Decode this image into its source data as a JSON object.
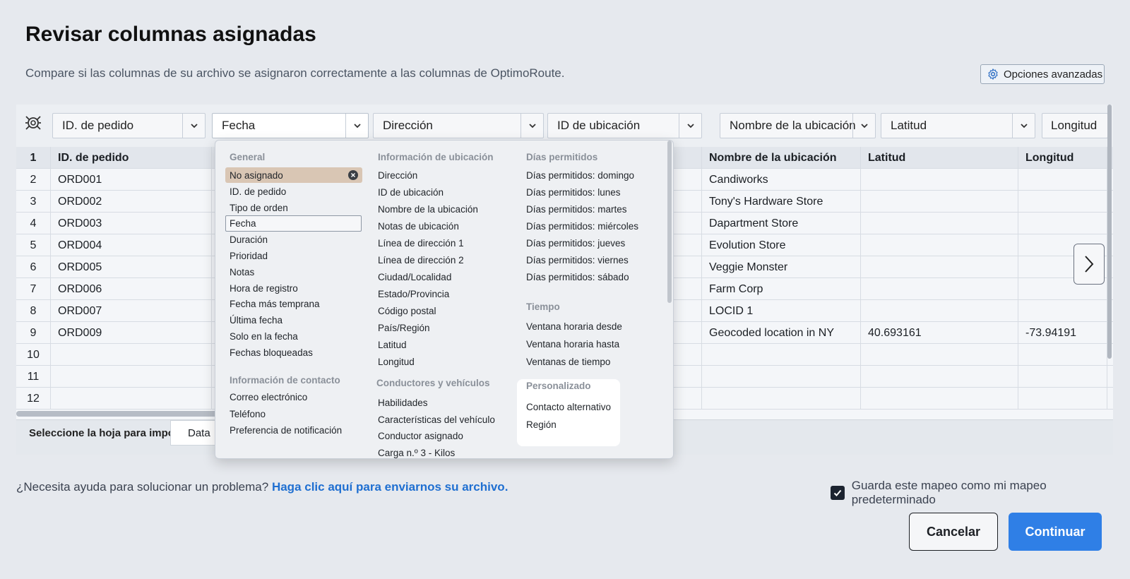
{
  "page": {
    "title": "Revisar columnas asignadas",
    "subtitle": "Compare si las columnas de su archivo se asignaron correctamente a las columnas de OptimoRoute.",
    "advanced_options": "Opciones avanzadas"
  },
  "mapping_selects": [
    {
      "label": "ID. de pedido"
    },
    {
      "label": "Fecha"
    },
    {
      "label": "Dirección"
    },
    {
      "label": "ID de ubicación"
    },
    {
      "label": "Nombre de la ubicación"
    },
    {
      "label": "Latitud"
    },
    {
      "label": "Longitud"
    }
  ],
  "table": {
    "header": {
      "num": "1",
      "c1": "ID. de pedido",
      "c5": "Nombre de la ubicación",
      "c6": "Latitud",
      "c7": "Longitud"
    },
    "rows": [
      {
        "num": "2",
        "c1": "ORD001",
        "c5": "Candiworks",
        "c6": "",
        "c7": ""
      },
      {
        "num": "3",
        "c1": "ORD002",
        "c5": "Tony's Hardware Store",
        "c6": "",
        "c7": ""
      },
      {
        "num": "4",
        "c1": "ORD003",
        "c5": "Dapartment Store",
        "c6": "",
        "c7": ""
      },
      {
        "num": "5",
        "c1": "ORD004",
        "c5": "Evolution Store",
        "c6": "",
        "c7": ""
      },
      {
        "num": "6",
        "c1": "ORD005",
        "c5": "Veggie Monster",
        "c6": "",
        "c7": ""
      },
      {
        "num": "7",
        "c1": "ORD006",
        "c5": "Farm Corp",
        "c6": "",
        "c7": ""
      },
      {
        "num": "8",
        "c1": "ORD007",
        "c5": "LOCID 1",
        "c6": "",
        "c7": ""
      },
      {
        "num": "9",
        "c1": "ORD009",
        "c5": "Geocoded location in NY",
        "c6": "40.693161",
        "c7": "-73.94191"
      },
      {
        "num": "10",
        "c1": "",
        "c5": "",
        "c6": "",
        "c7": ""
      },
      {
        "num": "11",
        "c1": "",
        "c5": "",
        "c6": "",
        "c7": ""
      },
      {
        "num": "12",
        "c1": "",
        "c5": "",
        "c6": "",
        "c7": ""
      }
    ]
  },
  "sheet_bar": {
    "label": "Seleccione la hoja para importar:",
    "tab": "Data"
  },
  "dropdown": {
    "general_head": "General",
    "general": [
      "No asignado",
      "ID. de pedido",
      "Tipo de orden",
      "Fecha",
      "Duración",
      "Prioridad",
      "Notas",
      "Hora de registro",
      "Fecha más temprana",
      "Última fecha",
      "Solo en la fecha",
      "Fechas bloqueadas"
    ],
    "contact_head": "Información de contacto",
    "contact": [
      "Correo electrónico",
      "Teléfono",
      "Preferencia de notificación"
    ],
    "location_head": "Información de ubicación",
    "location": [
      "Dirección",
      "ID de ubicación",
      "Nombre de la ubicación",
      "Notas de ubicación",
      "Línea de dirección 1",
      "Línea de dirección 2",
      "Ciudad/Localidad",
      "Estado/Provincia",
      "Código postal",
      "País/Región",
      "Latitud",
      "Longitud"
    ],
    "drivers_head": "Conductores y vehículos",
    "drivers": [
      "Habilidades",
      "Características del vehículo",
      "Conductor asignado",
      "Carga n.º 3 - Kilos"
    ],
    "days_head": "Días permitidos",
    "days": [
      "Días permitidos: domingo",
      "Días permitidos: lunes",
      "Días permitidos: martes",
      "Días permitidos: miércoles",
      "Días permitidos: jueves",
      "Días permitidos: viernes",
      "Días permitidos: sábado"
    ],
    "time_head": "Tiempo",
    "time": [
      "Ventana horaria desde",
      "Ventana horaria hasta",
      "Ventanas de tiempo"
    ],
    "custom_head": "Personalizado",
    "custom": [
      "Contacto alternativo",
      "Región"
    ]
  },
  "footer": {
    "help_text": "¿Necesita ayuda para solucionar un problema?",
    "help_link": "Haga clic aquí para enviarnos su archivo.",
    "save_default": "Guarda este mapeo como mi mapeo predeterminado",
    "save_default_checked": true,
    "cancel": "Cancelar",
    "continue": "Continuar"
  },
  "colors": {
    "accent": "#2f7fe6",
    "link": "#1f6fd1",
    "selected_bg": "#d9c6b4"
  }
}
